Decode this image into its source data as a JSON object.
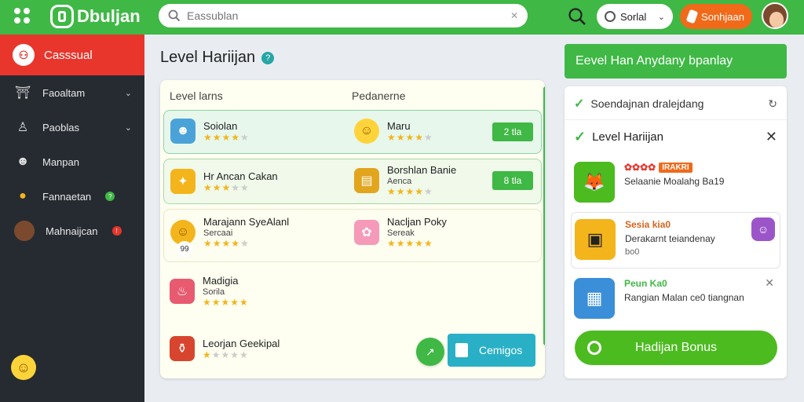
{
  "topbar": {
    "brand": "Dbuljan",
    "search_placeholder": "Eassublan",
    "select_value": "Sorlal",
    "shop_label": "Sonhjaan"
  },
  "sidebar": {
    "active": {
      "label": "Casssual"
    },
    "items": [
      {
        "label": "Faoaltam",
        "has_chevron": true
      },
      {
        "label": "Paoblas",
        "has_chevron": true
      },
      {
        "label": "Manpan",
        "has_chevron": false
      },
      {
        "label": "Fannaetan",
        "badge": "green"
      },
      {
        "label": "Mahnaijcan",
        "badge": "red"
      }
    ]
  },
  "page": {
    "title": "Level Hariijan",
    "help": "?"
  },
  "list": {
    "col1_header": "Level larns",
    "col2_header": "Pedanerne",
    "rows": [
      {
        "left": {
          "name": "Soiolan",
          "sub": "",
          "stars": 4
        },
        "right": {
          "name": "Maru",
          "sub": "",
          "stars": 4
        },
        "button": "2 tla"
      },
      {
        "left": {
          "name": "Hr Ancan Cakan",
          "sub": "",
          "stars": 3
        },
        "right": {
          "name": "Borshlan Banie",
          "sub": "Aenca",
          "stars": 4
        },
        "button": "8 tla"
      },
      {
        "left": {
          "name": "Marajann SyeAlanl",
          "sub": "Sercaai",
          "stars": 4,
          "chip": "99"
        },
        "right": {
          "name": "Nacljan Poky",
          "sub": "Sereak",
          "stars": 5
        }
      },
      {
        "left": {
          "name": "Madigia",
          "sub": "Sorila",
          "stars": 5
        }
      },
      {
        "left": {
          "name": "Leorjan Geekipal",
          "sub": "",
          "stars": 1
        }
      }
    ],
    "cta_label": "Cemigos"
  },
  "right_panel": {
    "banner": "Eevel Han Anydany bpanlay",
    "top_line": "Soendajnan dralejdang",
    "section_title": "Level Hariijan",
    "entries": [
      {
        "title": "",
        "tag": "IRAKRI",
        "line2": "Selaanie Moalahg Ba19",
        "line3": ""
      },
      {
        "title": "Sesia kia0",
        "tag": "",
        "line2": "Derakarnt teiandenay",
        "line3": "bo0"
      },
      {
        "title": "Peun Ka0",
        "tag": "",
        "line2": "Rangian Malan ce0 tiangnan",
        "line3": ""
      }
    ],
    "bonus_label": "Hadijan Bonus"
  },
  "colors": {
    "green": "#3fb845",
    "red": "#e8362c",
    "orange": "#f06a1a",
    "teal": "#29b0c6",
    "sidebar": "#262b31"
  }
}
